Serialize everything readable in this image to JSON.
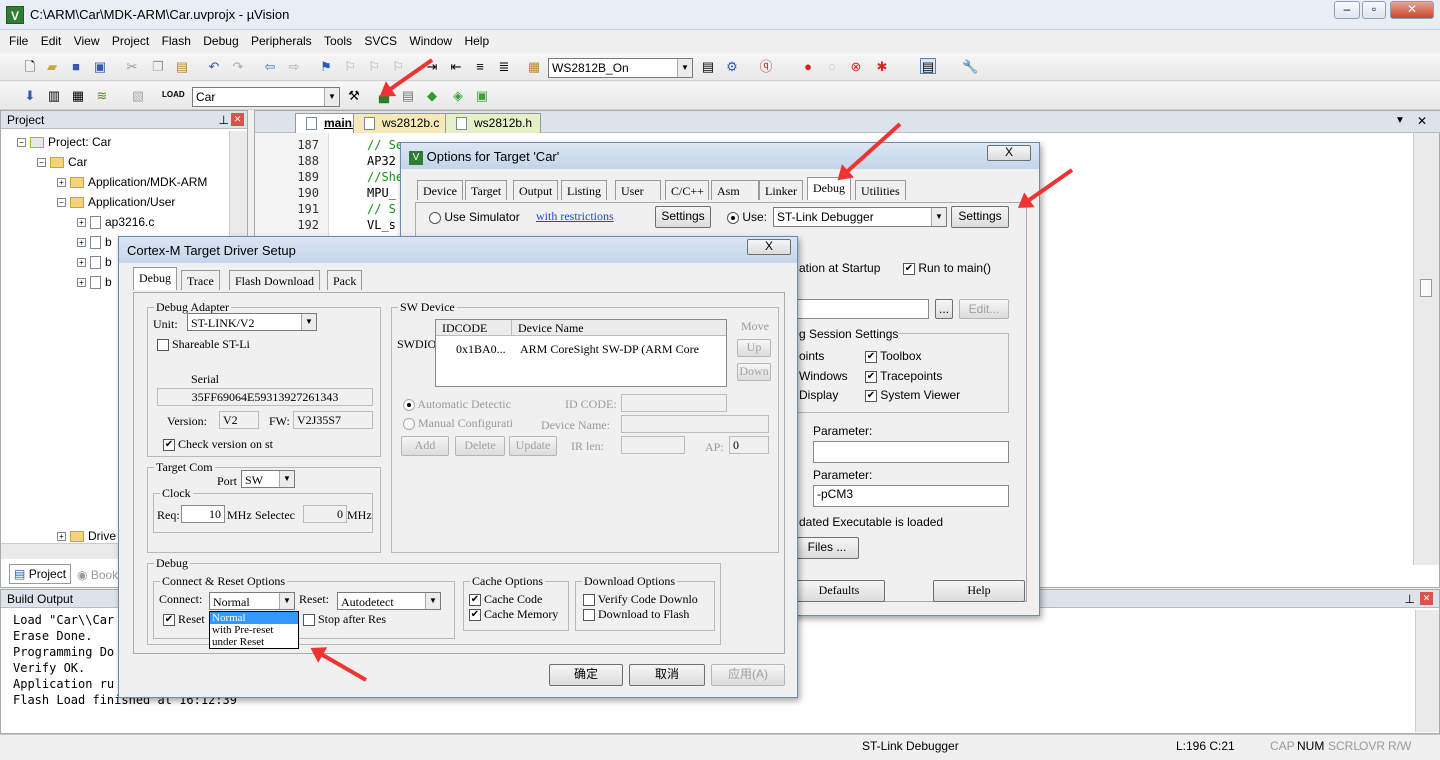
{
  "window": {
    "title": "C:\\ARM\\Car\\MDK-ARM\\Car.uvprojx - µVision",
    "app_icon": "uvision-icon"
  },
  "menu": [
    "File",
    "Edit",
    "View",
    "Project",
    "Flash",
    "Debug",
    "Peripherals",
    "Tools",
    "SVCS",
    "Window",
    "Help"
  ],
  "toolbar": {
    "target_combo": "WS2812B_On",
    "project_combo": "Car"
  },
  "project_panel": {
    "title": "Project",
    "root": "Project: Car",
    "target": "Car",
    "groups": [
      "Application/MDK-ARM",
      "Application/User"
    ],
    "files": [
      "ap3216.c"
    ],
    "more_group": "Drive",
    "tabs": [
      "Project",
      "Book"
    ]
  },
  "editor": {
    "tabs": [
      "main.c",
      "ws2812b.c",
      "ws2812b.h"
    ],
    "lines": [
      {
        "n": "187",
        "code": "// Se..."
      },
      {
        "n": "188",
        "code": "AP32"
      },
      {
        "n": "189",
        "code": "//She"
      },
      {
        "n": "190",
        "code": "MPU_"
      },
      {
        "n": "191",
        "code": "// S"
      },
      {
        "n": "192",
        "code": "VL_s"
      }
    ]
  },
  "build": {
    "title": "Build Output",
    "lines": [
      "Load \"Car\\\\Car",
      "Erase Done.",
      "Programming Do",
      "Verify OK.",
      "Application ru",
      "Flash Load finished at 16:12:39"
    ]
  },
  "status": {
    "debugger": "ST-Link Debugger",
    "position": "L:196 C:21",
    "indicators": [
      "CAP",
      "NUM",
      "SCRL",
      "OVR",
      "R/W"
    ]
  },
  "options_dialog": {
    "title": "Options for Target 'Car'",
    "close_label": "X",
    "tabs": [
      "Device",
      "Target",
      "Output",
      "Listing",
      "User",
      "C/C++",
      "Asm",
      "Linker",
      "Debug",
      "Utilities"
    ],
    "use_simulator": "Use Simulator",
    "with_restrictions": "with restrictions",
    "settings_label": "Settings",
    "use_label": "Use:",
    "debugger": "ST-Link Debugger",
    "settings2_label": "Settings",
    "startup_text": "ation at Startup",
    "run_to_main": "Run to main()",
    "edit_label": "Edit...",
    "ellipsis": "...",
    "session_title": "g Session Settings",
    "restore": [
      "oints",
      "Windows",
      "Display"
    ],
    "checks": [
      "Toolbox",
      "Tracepoints",
      "System Viewer"
    ],
    "param1_label": "Parameter:",
    "param2_label": "Parameter:",
    "param2_value": "-pCM3",
    "updated": "dated Executable is loaded",
    "files_btn": "Files ...",
    "defaults_btn": "Defaults",
    "help_btn": "Help"
  },
  "cortex_dialog": {
    "title": "Cortex-M Target Driver Setup",
    "close_label": "X",
    "tabs": [
      "Debug",
      "Trace",
      "Flash Download",
      "Pack"
    ],
    "adapter": {
      "title": "Debug Adapter",
      "unit_label": "Unit:",
      "unit": "ST-LINK/V2",
      "shareable": "Shareable ST-Li",
      "serial_label": "Serial",
      "serial": "35FF69064E59313927261343",
      "version_label": "Version:",
      "version": "V2",
      "fw_label": "FW:",
      "fw": "V2J35S7",
      "check_version": "Check version on st"
    },
    "target_com": {
      "title": "Target Com",
      "port_label": "Port",
      "port": "SW",
      "clock_title": "Clock",
      "req_label": "Req:",
      "req": "10",
      "mhz": "MHz",
      "selected_label": "Selectec",
      "selected": "0",
      "mhz2": "MHz"
    },
    "sw_device": {
      "title": "SW Device",
      "swdio": "SWDIO",
      "col_idcode": "IDCODE",
      "col_name": "Device Name",
      "row_id": "0x1BA0...",
      "row_name": "ARM CoreSight SW-DP (ARM Core",
      "move": "Move",
      "up": "Up",
      "down": "Down",
      "auto": "Automatic Detectic",
      "manual": "Manual Configurati",
      "id_code": "ID CODE:",
      "device_name": "Device Name:",
      "ir_len": "IR len:",
      "ap": "AP:",
      "ap_val": "0",
      "add": "Add",
      "delete": "Delete",
      "update": "Update"
    },
    "debug": {
      "title": "Debug",
      "connect_title": "Connect & Reset Options",
      "connect_label": "Connect:",
      "connect": "Normal",
      "reset_label": "Reset:",
      "reset": "Autodetect",
      "reset_after": "Reset",
      "stop_after": "Stop after Res",
      "options": [
        "Normal",
        "with Pre-reset",
        "under Reset"
      ],
      "cache_title": "Cache Options",
      "cache_code": "Cache Code",
      "cache_memory": "Cache Memory",
      "download_title": "Download Options",
      "verify": "Verify Code Downlo",
      "download_flash": "Download to Flash"
    },
    "ok": "确定",
    "cancel": "取消",
    "apply": "应用(A)"
  }
}
